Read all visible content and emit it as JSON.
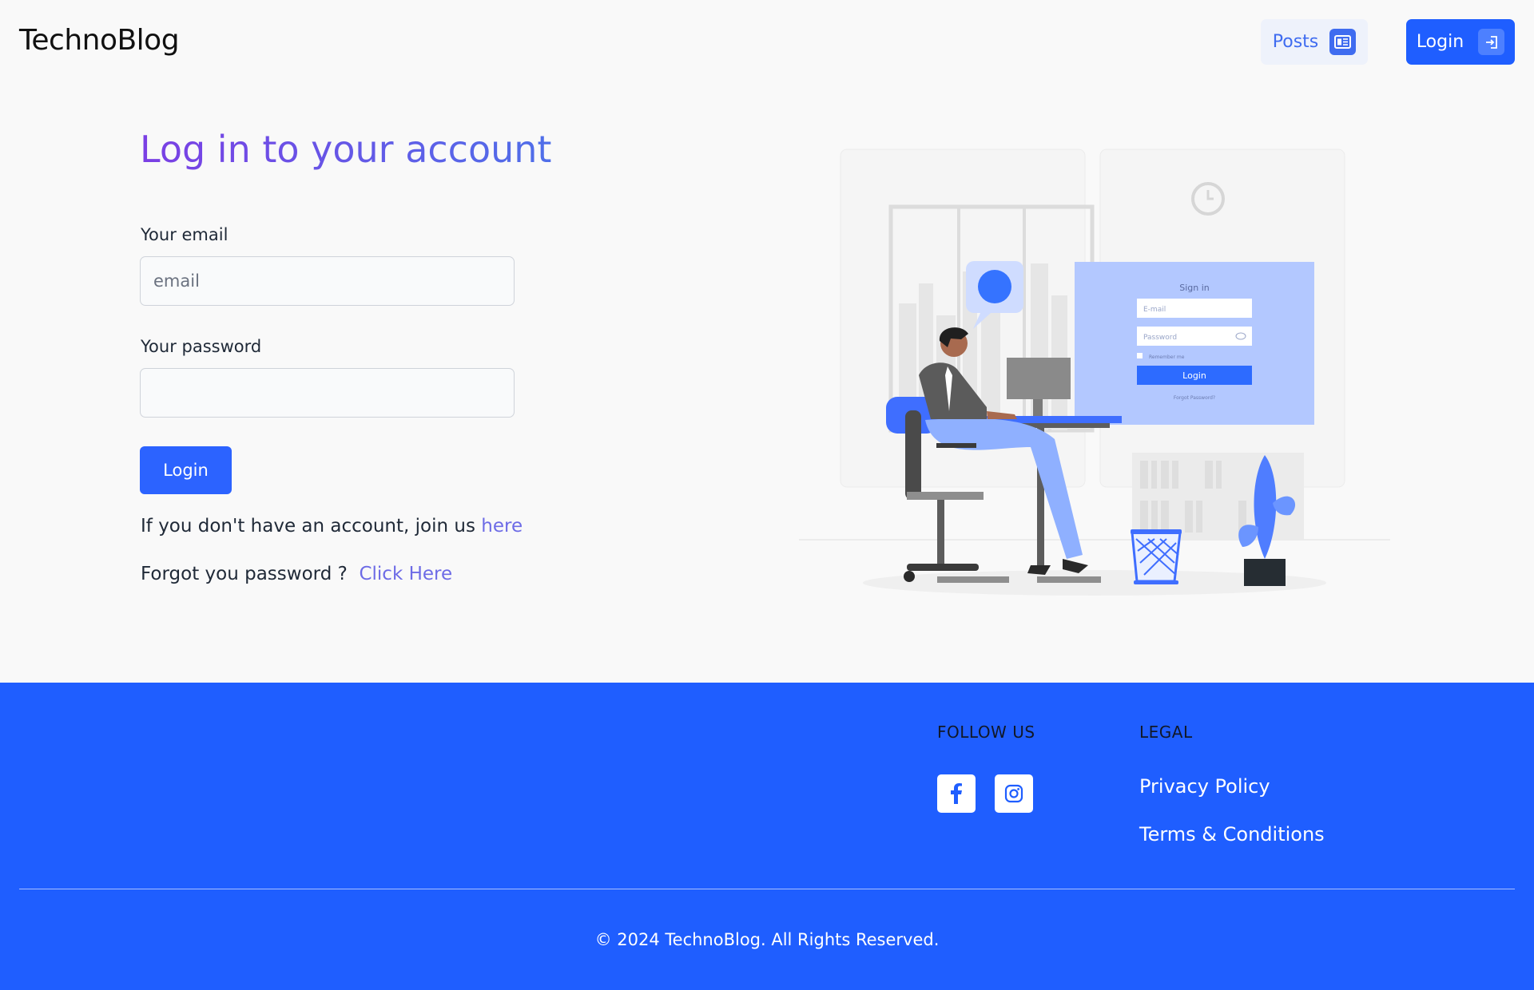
{
  "header": {
    "brand": "TechnoBlog",
    "nav": {
      "posts_label": "Posts",
      "login_label": "Login"
    }
  },
  "form": {
    "title": "Log in to your account",
    "email_label": "Your email",
    "email_placeholder": "email",
    "password_label": "Your password",
    "submit_label": "Login",
    "join_text": "If you don't have an account, join us",
    "join_link": "here",
    "forgot_text": "Forgot you password ?",
    "forgot_link": "Click Here"
  },
  "illustration": {
    "title": "Sign in",
    "email_placeholder": "E-mail",
    "password_placeholder": "Password",
    "remember_label": "Remember me",
    "login_label": "Login",
    "forgot_label": "Forgot Password?"
  },
  "footer": {
    "follow_heading": "FOLLOW US",
    "legal_heading": "LEGAL",
    "privacy": "Privacy Policy",
    "terms": "Terms & Conditions",
    "copyright": "© 2024 TechnoBlog. All Rights Reserved.",
    "social_icons": [
      "facebook-icon",
      "instagram-icon"
    ]
  },
  "colors": {
    "primary": "#1f5eff",
    "accent_light": "#eef2fb",
    "title_gradient_start": "#7b3fe4",
    "title_gradient_end": "#4f6fe9",
    "link": "#6d6be6"
  }
}
